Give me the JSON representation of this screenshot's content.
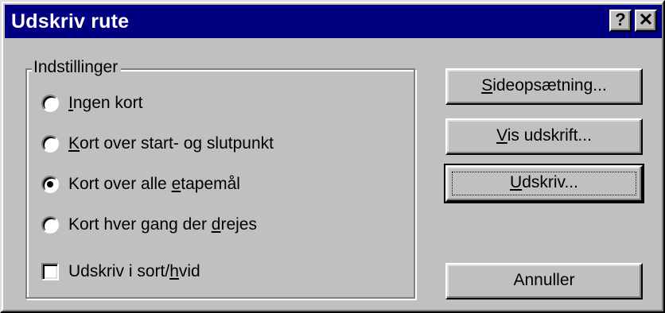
{
  "window": {
    "title": "Udskriv rute",
    "help_label": "?",
    "close_label": "✕"
  },
  "settings": {
    "group_label": "Indstillinger",
    "options": [
      {
        "label_pre": "",
        "accel": "I",
        "label_post": "ngen kort",
        "selected": false
      },
      {
        "label_pre": "",
        "accel": "K",
        "label_post": "ort over start- og slutpunkt",
        "selected": false
      },
      {
        "label_pre": "Kort over alle ",
        "accel": "e",
        "label_post": "tapemål",
        "selected": true
      },
      {
        "label_pre": "Kort hver gang der ",
        "accel": "d",
        "label_post": "rejes",
        "selected": false
      }
    ],
    "bw_checkbox": {
      "label_pre": "Udskriv i sort/",
      "accel": "h",
      "label_post": "vid",
      "checked": false
    }
  },
  "buttons": {
    "page_setup": {
      "accel": "S",
      "rest": "ideopsætning..."
    },
    "preview": {
      "accel": "V",
      "rest": "is udskrift..."
    },
    "print": {
      "accel": "U",
      "rest": "dskriv..."
    },
    "cancel": "Annuller"
  }
}
